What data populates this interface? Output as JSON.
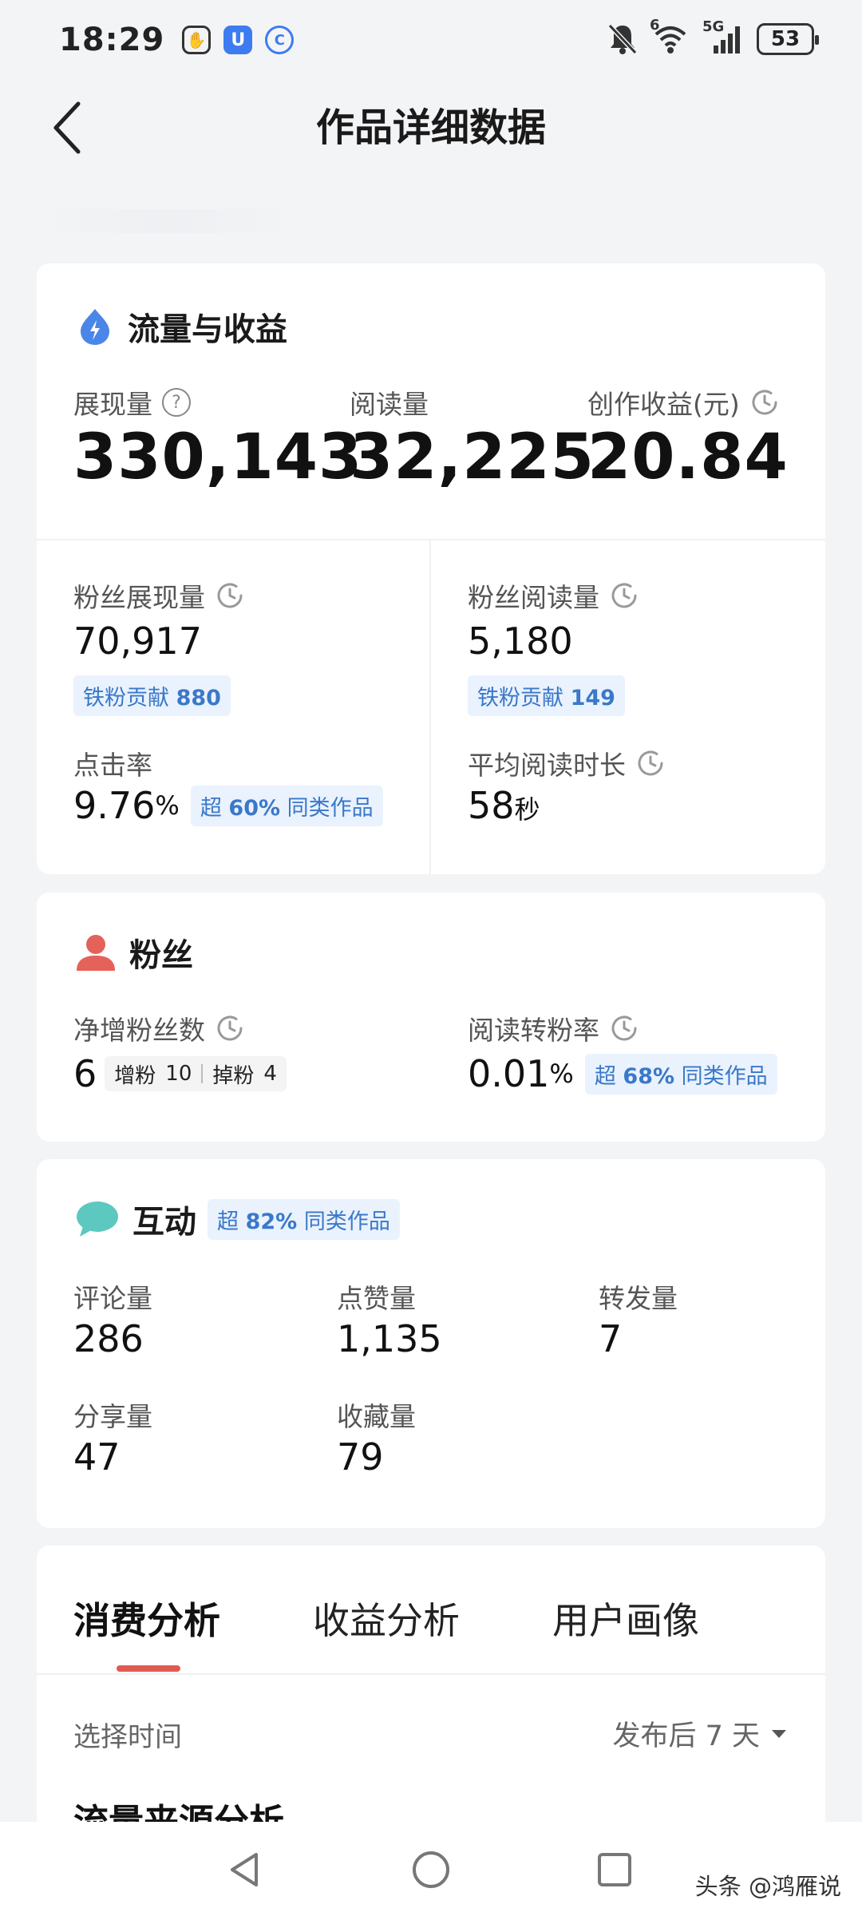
{
  "status_bar": {
    "time": "18:29",
    "battery": "53",
    "network": "5G",
    "wifi_badge": "6",
    "left_icons": [
      "hand-icon",
      "u-app-icon",
      "c-app-icon"
    ],
    "right_icons": [
      "mute-bell-icon",
      "wifi-icon",
      "signal-icon",
      "battery-icon"
    ]
  },
  "header": {
    "title": "作品详细数据",
    "back_icon": "chevron-left-icon"
  },
  "traffic": {
    "title": "流量与收益",
    "icon": "lightning-drop-icon",
    "impressions": {
      "label": "展现量",
      "value": "330,143"
    },
    "reads": {
      "label": "阅读量",
      "value": "32,225"
    },
    "earnings": {
      "label": "创作收益(元)",
      "value": "20.84"
    },
    "fan_impressions": {
      "label": "粉丝展现量",
      "value": "70,917",
      "badge_label": "铁粉贡献",
      "badge_value": "880"
    },
    "fan_reads": {
      "label": "粉丝阅读量",
      "value": "5,180",
      "badge_label": "铁粉贡献",
      "badge_value": "149"
    },
    "ctr": {
      "label": "点击率",
      "value": "9.76",
      "unit": "%",
      "badge_prefix": "超",
      "badge_value": "60%",
      "badge_suffix": "同类作品"
    },
    "avg_read_time": {
      "label": "平均阅读时长",
      "value": "58",
      "unit": "秒"
    }
  },
  "fans": {
    "title": "粉丝",
    "icon": "person-icon",
    "net_gain": {
      "label": "净增粉丝数",
      "value": "6",
      "gain_label": "增粉",
      "gain_value": "10",
      "loss_label": "掉粉",
      "loss_value": "4"
    },
    "conversion": {
      "label": "阅读转粉率",
      "value": "0.01",
      "unit": "%",
      "badge_prefix": "超",
      "badge_value": "68%",
      "badge_suffix": "同类作品"
    }
  },
  "interaction": {
    "title": "互动",
    "icon": "chat-bubble-icon",
    "badge_prefix": "超",
    "badge_value": "82%",
    "badge_suffix": "同类作品",
    "comments": {
      "label": "评论量",
      "value": "286"
    },
    "likes": {
      "label": "点赞量",
      "value": "1,135"
    },
    "reposts": {
      "label": "转发量",
      "value": "7"
    },
    "shares": {
      "label": "分享量",
      "value": "47"
    },
    "favorites": {
      "label": "收藏量",
      "value": "79"
    }
  },
  "analysis": {
    "tabs": [
      "消费分析",
      "收益分析",
      "用户画像"
    ],
    "active_tab": 0,
    "time_label": "选择时间",
    "time_value": "发布后 7 天",
    "section_title": "流量来源分析"
  },
  "nav": {
    "icons": [
      "back-triangle-icon",
      "home-circle-icon",
      "recents-square-icon"
    ],
    "watermark": "头条 @鸿雁说"
  },
  "colors": {
    "accent_blue": "#3a78c9",
    "badge_bg": "#e9f2fd",
    "tab_underline": "#e05a52",
    "fan_icon": "#e4625a",
    "chat_icon": "#5cc8c0"
  }
}
